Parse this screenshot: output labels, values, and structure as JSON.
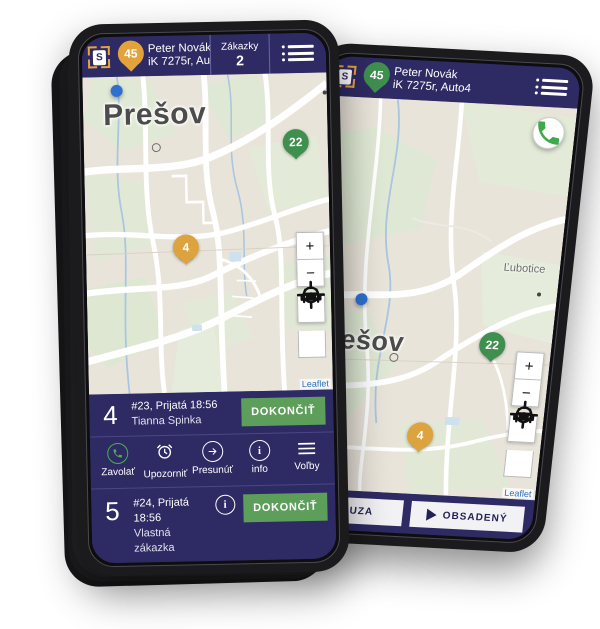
{
  "brand": {
    "logo_letter": "S",
    "accent_orange": "#e3a33c",
    "accent_green": "#3f8f4f",
    "header_navy": "#2e2a63",
    "button_green": "#5c9e5a"
  },
  "front_phone": {
    "header": {
      "logo_name": "scan-logo",
      "vehicle_badge": "45",
      "driver_name": "Peter Novák",
      "driver_sub": "iK 7275r, Au",
      "orders_label": "Zákazky",
      "orders_count": "2",
      "menu_name": "hamburger-menu"
    },
    "map": {
      "city_label": "Prešov",
      "markers": [
        {
          "label": "22",
          "color": "green"
        },
        {
          "label": "4",
          "color": "orange"
        }
      ],
      "controls": {
        "zoom_in": "+",
        "zoom_out": "−",
        "car": "car-icon",
        "locate": "crosshair-icon"
      },
      "attribution": "Leaflet"
    },
    "jobs": [
      {
        "number": "4",
        "line1": "#23, Prijatá 18:56",
        "line2": "Tianna Spinka",
        "button": "DOKONČIŤ",
        "has_info": false
      },
      {
        "number": "5",
        "line1": "#24, Prijatá 18:56",
        "line2": "Vlastná zákazka",
        "button": "DOKONČIŤ",
        "has_info": true,
        "info_label": "i"
      }
    ],
    "actions": [
      {
        "icon": "phone-icon",
        "label": "Zavolať"
      },
      {
        "icon": "alarm-clock-icon",
        "label": "Upozorniť"
      },
      {
        "icon": "arrow-right-icon",
        "label": "Presunúť"
      },
      {
        "icon": "info-icon",
        "label": "info"
      },
      {
        "icon": "list-icon",
        "label": "Voľby"
      }
    ]
  },
  "back_phone": {
    "header": {
      "logo_name": "scan-logo",
      "vehicle_badge": "45",
      "driver_name": "Peter Novák",
      "driver_sub": "iK 7275r, Auto4",
      "menu_name": "hamburger-menu"
    },
    "map": {
      "city_label": "Prešov",
      "place_label": "Ľubotice",
      "markers": [
        {
          "label": "22",
          "color": "green"
        },
        {
          "label": "4",
          "color": "orange"
        }
      ],
      "call_button": "phone-icon",
      "controls": {
        "zoom_in": "+",
        "zoom_out": "−",
        "car": "car-icon",
        "locate": "crosshair-icon"
      },
      "attribution": "Leaflet"
    },
    "status_buttons": [
      {
        "icon": "pause-icon",
        "label": "PAUZA"
      },
      {
        "icon": "play-icon",
        "label": "OBSADENÝ"
      }
    ]
  }
}
